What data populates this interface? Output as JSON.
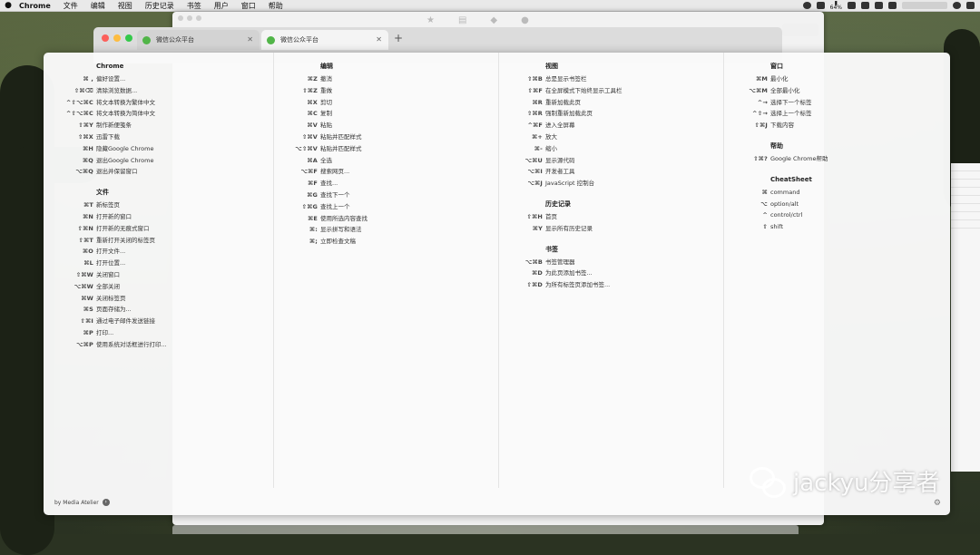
{
  "menubar": {
    "app": "Chrome",
    "items": [
      "文件",
      "编辑",
      "视图",
      "历史记录",
      "书签",
      "用户",
      "窗口",
      "帮助"
    ],
    "battery": "64%"
  },
  "tabs": [
    {
      "title": "微信公众平台"
    },
    {
      "title": "微信公众平台"
    }
  ],
  "cheatsheet": {
    "columns": [
      {
        "sections": [
          {
            "title": "Chrome",
            "rows": [
              {
                "keys": "⌘ ,",
                "action": "偏好设置..."
              },
              {
                "keys": "⇧⌘⌫",
                "action": "清除浏览数据..."
              },
              {
                "keys": "^⇧⌥⌘C",
                "action": "将文本转换为繁体中文"
              },
              {
                "keys": "^⇧⌥⌘C",
                "action": "将文本转换为简体中文"
              },
              {
                "keys": "⇧⌘Y",
                "action": "制作新便笺条"
              },
              {
                "keys": "⇧⌘X",
                "action": "迅雷下载"
              },
              {
                "keys": "⌘H",
                "action": "隐藏Google Chrome"
              },
              {
                "keys": "⌘Q",
                "action": "退出Google Chrome"
              },
              {
                "keys": "⌥⌘Q",
                "action": "退出并保留窗口"
              }
            ]
          },
          {
            "title": "文件",
            "rows": [
              {
                "keys": "⌘T",
                "action": "新标签页"
              },
              {
                "keys": "⌘N",
                "action": "打开新的窗口"
              },
              {
                "keys": "⇧⌘N",
                "action": "打开新的无痕式窗口"
              },
              {
                "keys": "⇧⌘T",
                "action": "重新打开关闭的标签页"
              },
              {
                "keys": "⌘O",
                "action": "打开文件..."
              },
              {
                "keys": "⌘L",
                "action": "打开位置..."
              },
              {
                "keys": "⇧⌘W",
                "action": "关闭窗口"
              },
              {
                "keys": "⌥⌘W",
                "action": "全部关闭"
              },
              {
                "keys": "⌘W",
                "action": "关闭标签页"
              },
              {
                "keys": "⌘S",
                "action": "页面存储为..."
              },
              {
                "keys": "⇧⌘I",
                "action": "通过电子邮件发送链接"
              },
              {
                "keys": "⌘P",
                "action": "打印..."
              },
              {
                "keys": "⌥⌘P",
                "action": "使用系统对话框进行打印..."
              }
            ]
          }
        ]
      },
      {
        "sections": [
          {
            "title": "编辑",
            "rows": [
              {
                "keys": "⌘Z",
                "action": "撤消"
              },
              {
                "keys": "⇧⌘Z",
                "action": "重做"
              },
              {
                "keys": "⌘X",
                "action": "剪切"
              },
              {
                "keys": "⌘C",
                "action": "复制"
              },
              {
                "keys": "⌘V",
                "action": "粘贴"
              },
              {
                "keys": "⇧⌘V",
                "action": "粘贴并匹配样式"
              },
              {
                "keys": "⌥⇧⌘V",
                "action": "粘贴并匹配样式"
              },
              {
                "keys": "⌘A",
                "action": "全选"
              },
              {
                "keys": "⌥⌘F",
                "action": "搜索网页..."
              },
              {
                "keys": "⌘F",
                "action": "查找..."
              },
              {
                "keys": "⌘G",
                "action": "查找下一个"
              },
              {
                "keys": "⇧⌘G",
                "action": "查找上一个"
              },
              {
                "keys": "⌘E",
                "action": "使用所选内容查找"
              },
              {
                "keys": "⌘:",
                "action": "显示拼写和语法"
              },
              {
                "keys": "⌘;",
                "action": "立即检查文稿"
              }
            ]
          }
        ]
      },
      {
        "sections": [
          {
            "title": "视图",
            "rows": [
              {
                "keys": "⇧⌘B",
                "action": "总是显示书签栏"
              },
              {
                "keys": "⇧⌘F",
                "action": "在全屏模式下始终显示工具栏"
              },
              {
                "keys": "⌘R",
                "action": "重新加载此页"
              },
              {
                "keys": "⇧⌘R",
                "action": "强制重新加载此页"
              },
              {
                "keys": "^⌘F",
                "action": "进入全屏幕"
              },
              {
                "keys": "⌘+",
                "action": "放大"
              },
              {
                "keys": "⌘-",
                "action": "缩小"
              },
              {
                "keys": "⌥⌘U",
                "action": "显示源代码"
              },
              {
                "keys": "⌥⌘I",
                "action": "开发者工具"
              },
              {
                "keys": "⌥⌘J",
                "action": "JavaScript 控制台"
              }
            ]
          },
          {
            "title": "历史记录",
            "rows": [
              {
                "keys": "⇧⌘H",
                "action": "首页"
              },
              {
                "keys": "⌘Y",
                "action": "显示所有历史记录"
              }
            ]
          },
          {
            "title": "书签",
            "rows": [
              {
                "keys": "⌥⌘B",
                "action": "书签管理器"
              },
              {
                "keys": "⌘D",
                "action": "为此页添加书签..."
              },
              {
                "keys": "⇧⌘D",
                "action": "为所有标签页添加书签..."
              }
            ]
          }
        ]
      },
      {
        "sections": [
          {
            "title": "窗口",
            "rows": [
              {
                "keys": "⌘M",
                "action": "最小化"
              },
              {
                "keys": "⌥⌘M",
                "action": "全部最小化"
              },
              {
                "keys": "^→",
                "action": "选择下一个标签"
              },
              {
                "keys": "^⇧→",
                "action": "选择上一个标签"
              },
              {
                "keys": "⇧⌘J",
                "action": "下载内容"
              }
            ]
          },
          {
            "title": "帮助",
            "rows": [
              {
                "keys": "⇧⌘?",
                "action": "Google Chrome帮助"
              }
            ]
          },
          {
            "title": "CheatSheet",
            "rows": [
              {
                "keys": "⌘",
                "action": "command"
              },
              {
                "keys": "⌥",
                "action": "option/alt"
              },
              {
                "keys": "^",
                "action": "control/ctrl"
              },
              {
                "keys": "⇧",
                "action": "shift"
              }
            ]
          }
        ]
      }
    ],
    "footer": "by Media Atelier"
  },
  "watermark": "jackyu分享者",
  "colors": {
    "traffic_red": "#fc605b",
    "traffic_yellow": "#fdbc40",
    "traffic_green": "#34c84a",
    "wechat_green": "#51b548"
  }
}
